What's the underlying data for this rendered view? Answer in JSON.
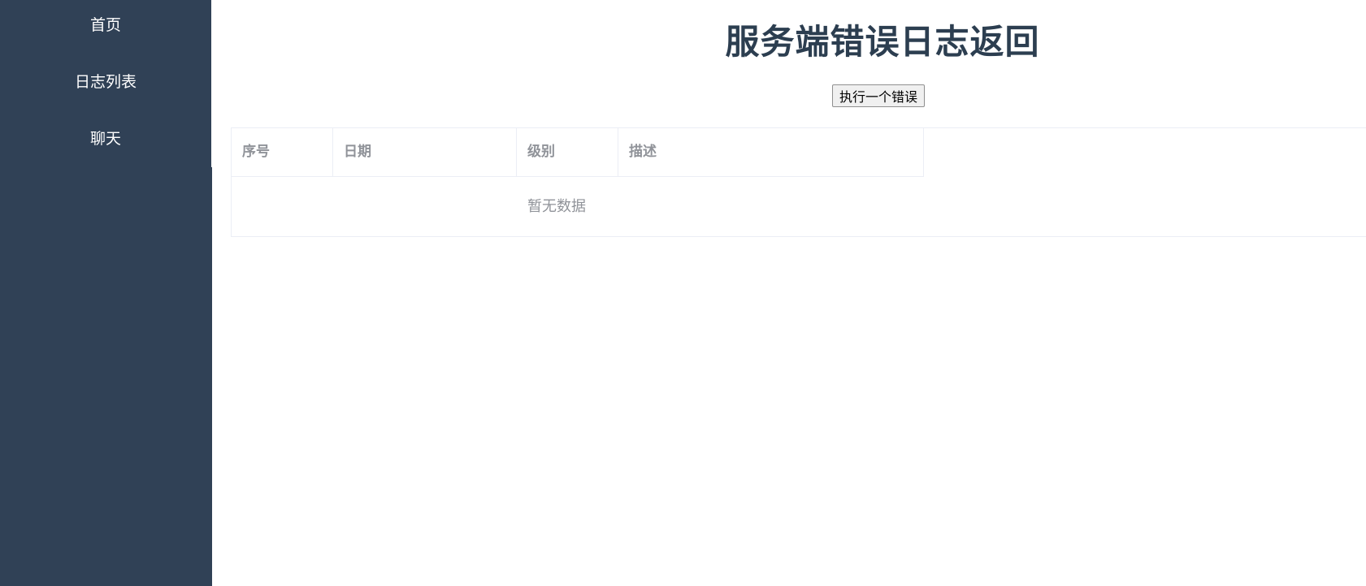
{
  "sidebar": {
    "items": [
      {
        "label": "首页"
      },
      {
        "label": "日志列表"
      },
      {
        "label": "聊天"
      }
    ]
  },
  "main": {
    "title": "服务端错误日志返回",
    "run_error_button": "执行一个错误",
    "table": {
      "columns": [
        "序号",
        "日期",
        "级别",
        "描述"
      ],
      "rows": [],
      "empty_text": "暂无数据"
    }
  },
  "colors": {
    "sidebar_bg": "#304156",
    "title": "#2c3e50",
    "table_header_text": "#909399",
    "table_border": "#ebeef5"
  }
}
